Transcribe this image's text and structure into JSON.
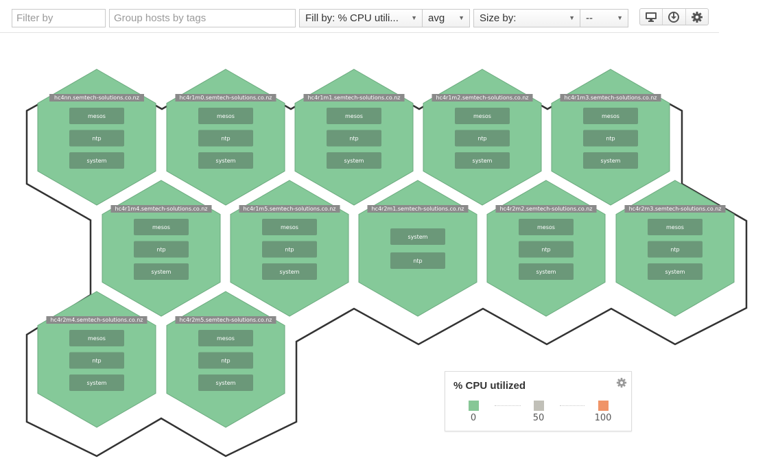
{
  "toolbar": {
    "filter_placeholder": "Filter by",
    "group_placeholder": "Group hosts by tags",
    "fill_by_label": "Fill by: % CPU utili...",
    "fill_aggregation": "avg",
    "size_by_label": "Size by:",
    "size_aggregation": "--",
    "icons": [
      "monitor-icon",
      "download-icon",
      "gear-icon"
    ]
  },
  "colors": {
    "hex_fill": "#85c999",
    "hex_stroke": "#6aa97d",
    "tag_fill": "#6b9879",
    "host_label_bg": "#8a8a8a",
    "group_outline": "#333333",
    "legend_low": "#87c796",
    "legend_mid": "#c1c0b8",
    "legend_high": "#f09468"
  },
  "hosts": [
    {
      "name": "hc4nn.semtech-solutions.co.nz",
      "tags": [
        "mesos",
        "ntp",
        "system"
      ]
    },
    {
      "name": "hc4r1m0.semtech-solutions.co.nz",
      "tags": [
        "mesos",
        "ntp",
        "system"
      ]
    },
    {
      "name": "hc4r1m1.semtech-solutions.co.nz",
      "tags": [
        "mesos",
        "ntp",
        "system"
      ]
    },
    {
      "name": "hc4r1m2.semtech-solutions.co.nz",
      "tags": [
        "mesos",
        "ntp",
        "system"
      ]
    },
    {
      "name": "hc4r1m3.semtech-solutions.co.nz",
      "tags": [
        "mesos",
        "ntp",
        "system"
      ]
    },
    {
      "name": "hc4r1m4.semtech-solutions.co.nz",
      "tags": [
        "mesos",
        "ntp",
        "system"
      ]
    },
    {
      "name": "hc4r1m5.semtech-solutions.co.nz",
      "tags": [
        "mesos",
        "ntp",
        "system"
      ]
    },
    {
      "name": "hc4r2m1.semtech-solutions.co.nz",
      "tags": [
        "system",
        "ntp"
      ]
    },
    {
      "name": "hc4r2m2.semtech-solutions.co.nz",
      "tags": [
        "mesos",
        "ntp",
        "system"
      ]
    },
    {
      "name": "hc4r2m3.semtech-solutions.co.nz",
      "tags": [
        "mesos",
        "ntp",
        "system"
      ]
    },
    {
      "name": "hc4r2m4.semtech-solutions.co.nz",
      "tags": [
        "mesos",
        "ntp",
        "system"
      ]
    },
    {
      "name": "hc4r2m5.semtech-solutions.co.nz",
      "tags": [
        "mesos",
        "ntp",
        "system"
      ]
    }
  ],
  "legend": {
    "title": "% CPU utilized",
    "ticks": [
      "0",
      "50",
      "100"
    ]
  }
}
